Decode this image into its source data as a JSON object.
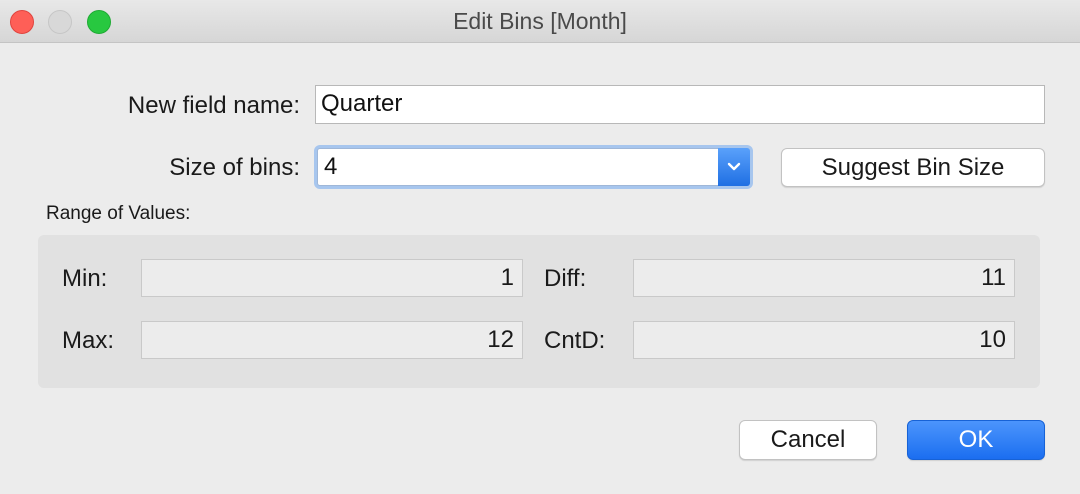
{
  "window": {
    "title": "Edit Bins [Month]"
  },
  "form": {
    "field_name_label": "New field name:",
    "field_name_value": "Quarter",
    "bin_size_label": "Size of bins:",
    "bin_size_value": "4",
    "suggest_button": "Suggest Bin Size"
  },
  "range": {
    "heading": "Range of Values:",
    "min_label": "Min:",
    "min_value": "1",
    "max_label": "Max:",
    "max_value": "12",
    "diff_label": "Diff:",
    "diff_value": "11",
    "cntd_label": "CntD:",
    "cntd_value": "10"
  },
  "actions": {
    "cancel": "Cancel",
    "ok": "OK"
  },
  "icons": {
    "close": "close-icon",
    "minimize": "minimize-icon",
    "zoom": "zoom-icon",
    "dropdown": "chevron-down-icon"
  },
  "colors": {
    "accent": "#1b6ef0",
    "close": "#fe5f57",
    "zoom": "#28c840"
  }
}
